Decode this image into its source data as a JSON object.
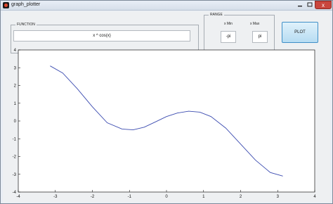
{
  "window": {
    "title": "graph_plotter",
    "close_glyph": "x"
  },
  "function_panel": {
    "title": "FUNCTION",
    "value": "x ^ cos(x)"
  },
  "range_panel": {
    "title": "RANGE",
    "xmin_label": "x Min",
    "xmax_label": "x Max",
    "xmin_value": "-pi",
    "xmax_value": "pi"
  },
  "plot_button": {
    "label": "PLOT"
  },
  "chart_data": {
    "type": "line",
    "xlim": [
      -4,
      4
    ],
    "ylim": [
      -4,
      4
    ],
    "xticks": [
      "-4",
      "-3",
      "-2",
      "-1",
      "0",
      "1",
      "2",
      "3",
      "4"
    ],
    "yticks": [
      "4",
      "3",
      "2",
      "1",
      "0",
      "-1",
      "-2",
      "-3",
      "-4"
    ],
    "grid": false,
    "line_color": "#3b4bb0",
    "x": [
      -3.14,
      -2.8,
      -2.4,
      -2.0,
      -1.6,
      -1.2,
      -0.9,
      -0.6,
      -0.3,
      0.0,
      0.3,
      0.6,
      0.9,
      1.2,
      1.6,
      2.0,
      2.4,
      2.8,
      3.14
    ],
    "y": [
      3.1,
      2.7,
      1.8,
      0.8,
      -0.1,
      -0.45,
      -0.5,
      -0.35,
      -0.05,
      0.25,
      0.45,
      0.55,
      0.5,
      0.25,
      -0.4,
      -1.3,
      -2.2,
      -2.9,
      -3.1
    ]
  }
}
